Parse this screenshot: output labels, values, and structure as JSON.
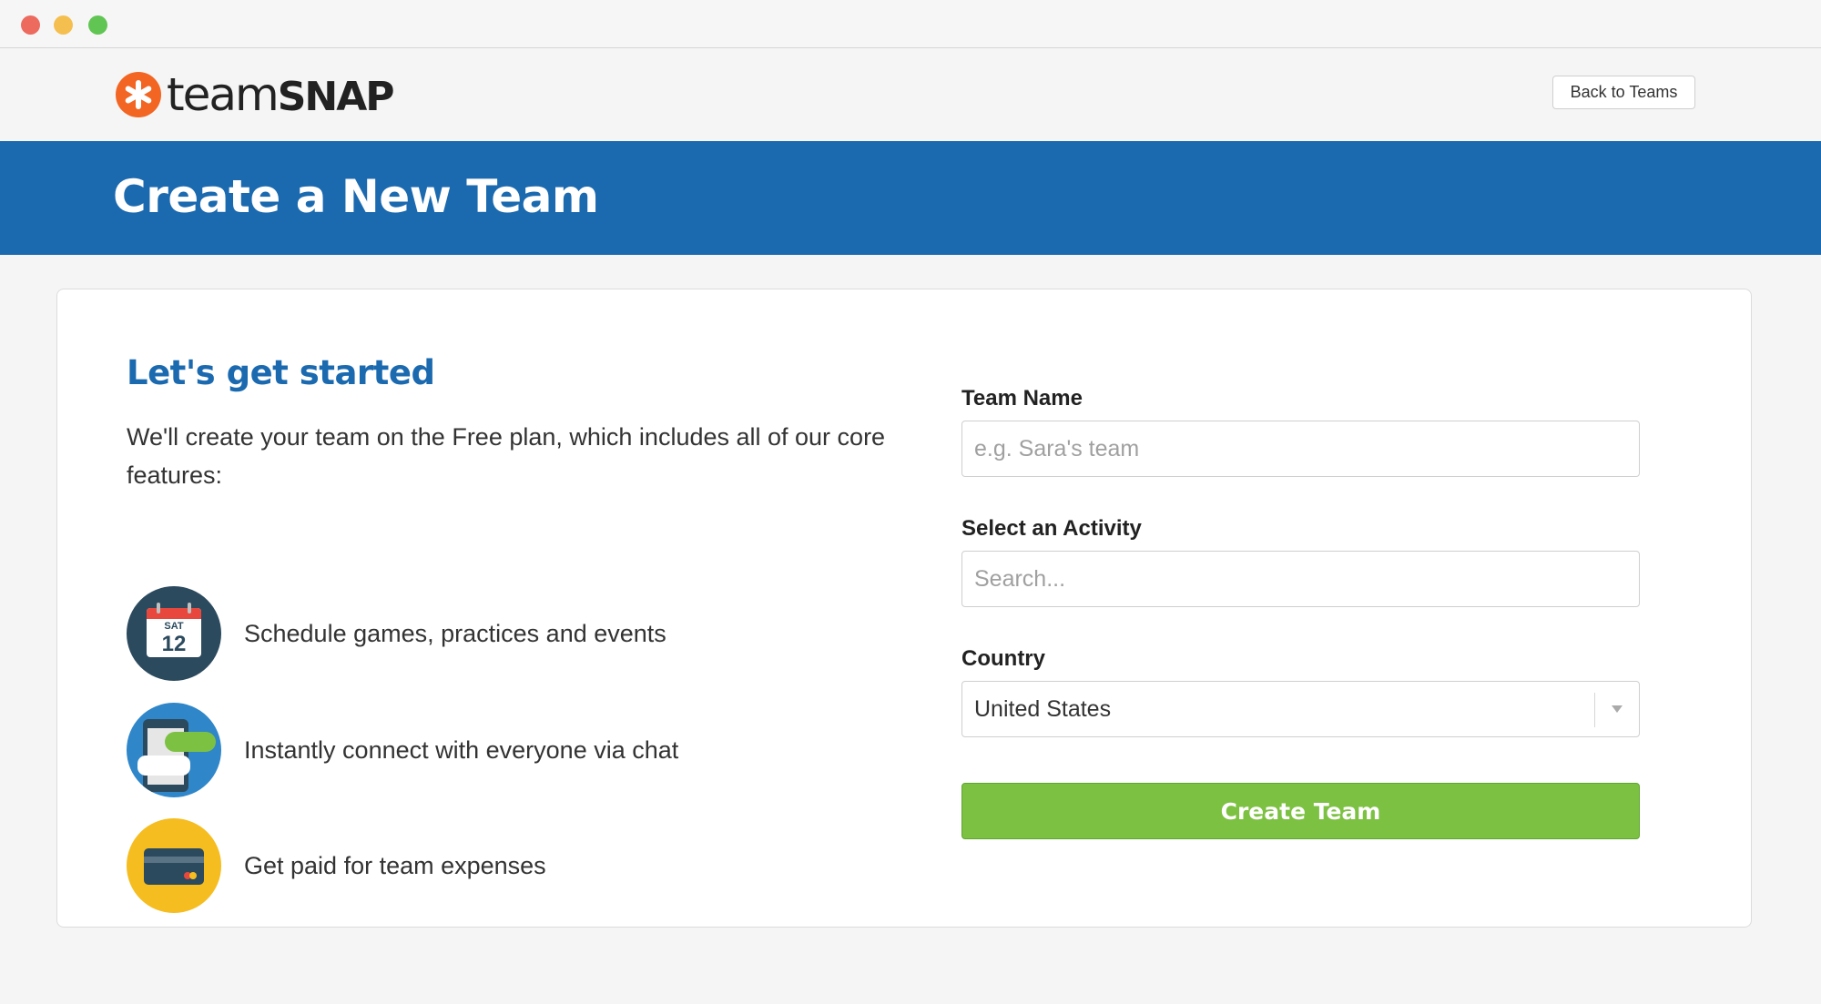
{
  "header": {
    "logo_team": "team",
    "logo_snap": "SNAP",
    "back_button": "Back to Teams"
  },
  "banner": {
    "title": "Create a New Team"
  },
  "intro": {
    "heading": "Let's get started",
    "description": "We'll create your team on the Free plan, which includes all of our core features:"
  },
  "features": [
    {
      "icon": "calendar-icon",
      "calendar_day": "SAT",
      "calendar_date": "12",
      "text": "Schedule games, practices and events"
    },
    {
      "icon": "chat-icon",
      "text": "Instantly connect with everyone via chat"
    },
    {
      "icon": "credit-card-icon",
      "text": "Get paid for team expenses"
    }
  ],
  "form": {
    "team_name_label": "Team Name",
    "team_name_placeholder": "e.g. Sara's team",
    "activity_label": "Select an Activity",
    "activity_placeholder": "Search...",
    "country_label": "Country",
    "country_value": "United States",
    "submit_label": "Create Team"
  },
  "colors": {
    "brand_blue": "#1b6ab0",
    "logo_orange": "#f26522",
    "button_green": "#7dc142"
  }
}
